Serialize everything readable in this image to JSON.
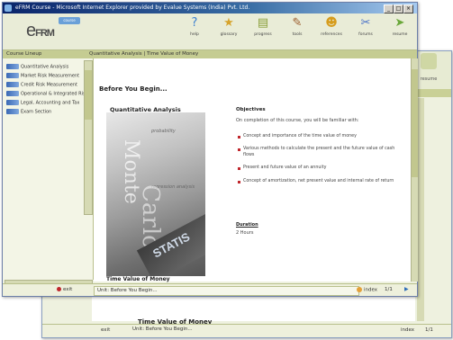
{
  "window": {
    "title": "eFRM Course - Microsoft Internet Explorer provided by Evalue Systems (India) Pvt. Ltd.",
    "min_icon": "minimize-icon",
    "max_icon": "maximize-icon",
    "close_icon": "close-icon"
  },
  "toolbar": {
    "logo_prefix": "e",
    "logo_text": "FRM",
    "badge": "course",
    "buttons": [
      {
        "label": "help",
        "icon": "help-icon",
        "glyph": "?",
        "color": "#3a7fd0"
      },
      {
        "label": "glossary",
        "icon": "glossary-icon",
        "glyph": "★",
        "color": "#d6a32b"
      },
      {
        "label": "progress",
        "icon": "progress-icon",
        "glyph": "▤",
        "color": "#8a9f3a"
      },
      {
        "label": "tools",
        "icon": "tools-icon",
        "glyph": "✎",
        "color": "#9a5a2a"
      },
      {
        "label": "references",
        "icon": "references-icon",
        "glyph": "☻",
        "color": "#d69c1c"
      },
      {
        "label": "forums",
        "icon": "forums-icon",
        "glyph": "✂",
        "color": "#4a72c8"
      },
      {
        "label": "resume",
        "icon": "resume-icon",
        "glyph": "➤",
        "color": "#6aa83a"
      }
    ]
  },
  "coursebar": {
    "left": "Course Lineup",
    "right": "Quantitative Analysis | Time Value of Money"
  },
  "sidebar": {
    "items": [
      {
        "label": "Quantitative Analysis"
      },
      {
        "label": "Market Risk Measurement"
      },
      {
        "label": "Credit Risk Measurement"
      },
      {
        "label": "Operational & Integrated Risk"
      },
      {
        "label": "Legal, Accounting and Tax"
      },
      {
        "label": "Exam Section"
      }
    ]
  },
  "content": {
    "heading": "Before You Begin...",
    "section_title": "Quantitative Analysis",
    "cover_words": [
      "Monte",
      "Carlo",
      "STATIS"
    ],
    "cover_tags": [
      "probability",
      "regression analysis"
    ],
    "caption": "Time Value of Money",
    "objectives": {
      "title": "Objectives",
      "intro": "On completion of this course, you will be familiar with:",
      "bullets": [
        "Concept and importance of the time value of money",
        "Various methods to calculate the present and the future value of cash flows",
        "Present and future value of an annuity",
        "Concept of amortization, net present value and internal rate of return"
      ]
    },
    "duration": {
      "label": "Duration",
      "value": "2 Hours"
    }
  },
  "status": {
    "exit": "exit",
    "unit": "Unit: Before You Begin...",
    "index": "index",
    "page": "1/1",
    "next": "▶"
  },
  "background": {
    "caption": "Time Value of Money",
    "unit": "Unit: Before You Begin...",
    "exit": "exit",
    "index": "index",
    "page": "1/1",
    "resume": "resume"
  }
}
